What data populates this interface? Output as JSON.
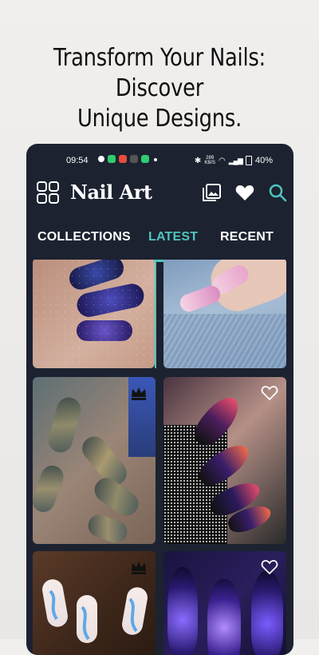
{
  "headline": {
    "line1": "Transform Your Nails: Discover",
    "line2": "Unique Designs."
  },
  "status_bar": {
    "time": "09:54",
    "network_speed_value": "289",
    "network_speed_unit": "KB/S",
    "battery": "40%"
  },
  "app_bar": {
    "title": "Nail Art",
    "icons": [
      "grid-icon",
      "gallery-icon",
      "heart-icon",
      "search-icon"
    ]
  },
  "tabs": [
    {
      "label": "COLLECTIONS",
      "active": false
    },
    {
      "label": "LATEST",
      "active": true
    },
    {
      "label": "RECENT",
      "active": false
    }
  ],
  "cards": [
    {
      "name": "galaxy-purple-nails",
      "badge": "none"
    },
    {
      "name": "pink-chrome-nails-denim",
      "badge": "none"
    },
    {
      "name": "holographic-almond-nails",
      "badge": "crown-icon"
    },
    {
      "name": "galaxy-stiletto-nails",
      "badge": "heart-outline-icon"
    },
    {
      "name": "blue-swirl-nails",
      "badge": "crown-icon"
    },
    {
      "name": "purple-smoke-nails",
      "badge": "heart-outline-icon"
    }
  ],
  "colors": {
    "background": "#efedeb",
    "phone": "#1c2230",
    "accent": "#4fc4bf",
    "text_light": "#ffffff"
  }
}
